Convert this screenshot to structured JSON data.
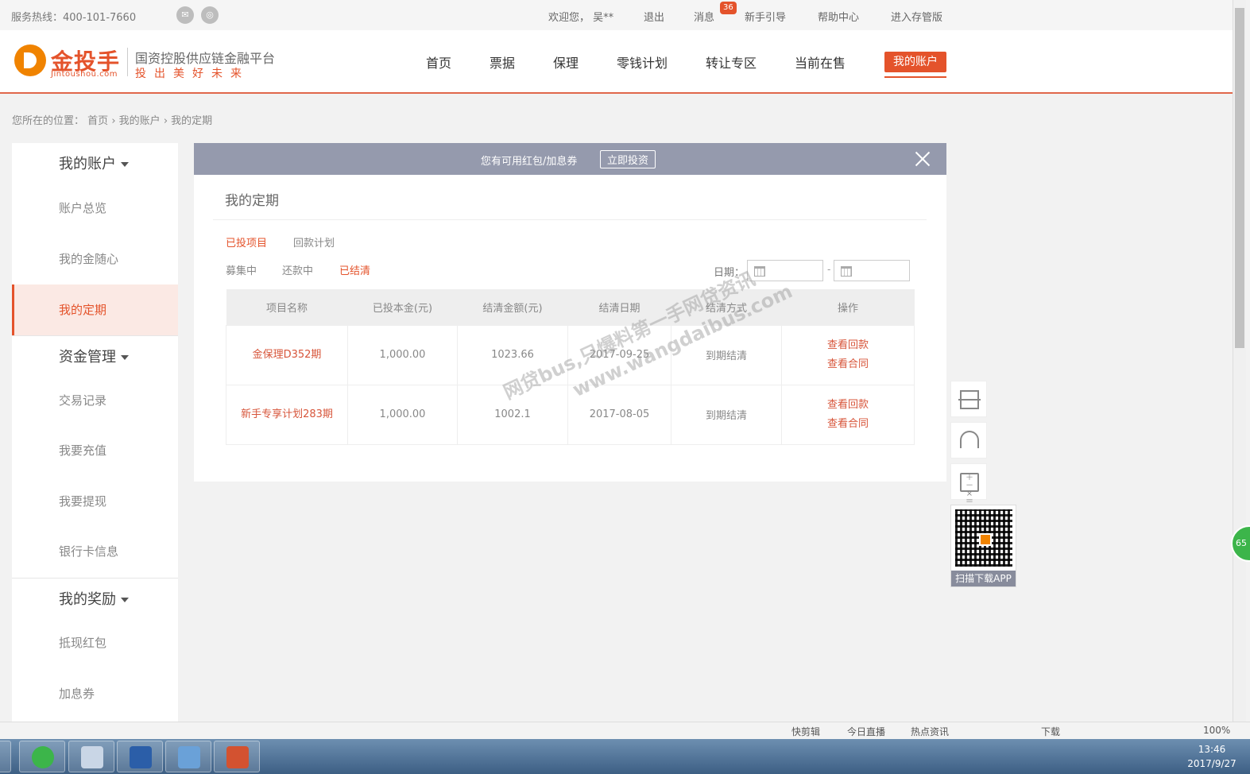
{
  "topbar": {
    "hotline": "服务热线：400-101-7660",
    "welcome": "欢迎您， 吴**",
    "logout": "退出",
    "messages": "消息",
    "message_count": "36",
    "guide": "新手引导",
    "help": "帮助中心",
    "custody": "进入存管版"
  },
  "header": {
    "logo_text": "金投手",
    "logo_url": "Jintoushou.com",
    "slogan": "国资控股供应链金融平台",
    "motto": "投出美好未来",
    "nav": [
      "首页",
      "票据",
      "保理",
      "零钱计划",
      "转让专区",
      "当前在售"
    ],
    "nav_active": "我的账户"
  },
  "breadcrumb": {
    "prefix": "您所在的位置：",
    "items": [
      "首页",
      "我的账户",
      "我的定期"
    ]
  },
  "sidebar": {
    "groups": [
      {
        "title": "我的账户",
        "items": [
          "账户总览",
          "我的金随心",
          "我的定期"
        ]
      },
      {
        "title": "资金管理",
        "items": [
          "交易记录",
          "我要充值",
          "我要提现",
          "银行卡信息"
        ]
      },
      {
        "title": "我的奖励",
        "items": [
          "抵现红包",
          "加息券"
        ]
      }
    ],
    "active": "我的定期"
  },
  "banner": {
    "text": "您有可用红包/加息券",
    "button": "立即投资"
  },
  "main": {
    "title": "我的定期",
    "tabs": [
      "已投项目",
      "回款计划"
    ],
    "filters": [
      "募集中",
      "还款中",
      "已结清"
    ],
    "date_label": "日期：",
    "date_sep": "-"
  },
  "table": {
    "headers": [
      "项目名称",
      "已投本金(元)",
      "结清金额(元)",
      "结清日期",
      "结清方式",
      "操作"
    ],
    "rows": [
      {
        "name": "金保理D352期",
        "principal": "1,000.00",
        "amount": "1023.66",
        "date": "2017-09-25",
        "method": "到期结清",
        "action1": "查看回款",
        "action2": "查看合同"
      },
      {
        "name": "新手专享计划283期",
        "principal": "1,000.00",
        "amount": "1002.1",
        "date": "2017-08-05",
        "method": "到期结清",
        "action1": "查看回款",
        "action2": "查看合同"
      }
    ]
  },
  "watermark": {
    "line1": "网贷bus,只爆料第一手网贷资讯",
    "line2": "www.wangdaibus.com"
  },
  "side_tools": {
    "qr_label": "扫描下载APP"
  },
  "bubble": "65",
  "statusbar": {
    "items": [
      "快剪辑",
      "今日直播",
      "热点资讯",
      "下载",
      "100%"
    ]
  },
  "clock": {
    "time": "13:46",
    "date": "2017/9/27"
  },
  "colors": {
    "accent": "#e4532b",
    "banner": "#959aad"
  }
}
